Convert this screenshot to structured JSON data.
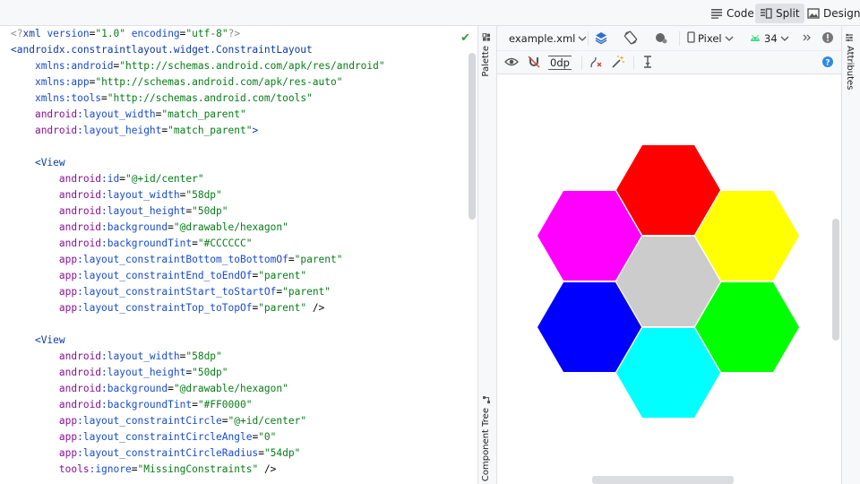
{
  "view_modes": {
    "code": "Code",
    "split": "Split",
    "design": "Design",
    "active": "split"
  },
  "editor": {
    "lines": [
      [
        {
          "t": "<?",
          "c": "dim"
        },
        {
          "t": "xml ",
          "c": "tag"
        },
        {
          "t": "version",
          "c": "an"
        },
        {
          "t": "=",
          "c": "plain"
        },
        {
          "t": "\"1.0\"",
          "c": "str"
        },
        {
          "t": " ",
          "c": "plain"
        },
        {
          "t": "encoding",
          "c": "an"
        },
        {
          "t": "=",
          "c": "plain"
        },
        {
          "t": "\"utf-8\"",
          "c": "str"
        },
        {
          "t": "?>",
          "c": "dim"
        }
      ],
      [
        {
          "t": "<androidx.constraintlayout.widget.ConstraintLayout",
          "c": "tag"
        }
      ],
      [
        {
          "t": "    ",
          "c": "plain"
        },
        {
          "t": "xmlns:android",
          "c": "an"
        },
        {
          "t": "=",
          "c": "plain"
        },
        {
          "t": "\"http://schemas.android.com/apk/res/android\"",
          "c": "str"
        }
      ],
      [
        {
          "t": "    ",
          "c": "plain"
        },
        {
          "t": "xmlns:app",
          "c": "an"
        },
        {
          "t": "=",
          "c": "plain"
        },
        {
          "t": "\"http://schemas.android.com/apk/res-auto\"",
          "c": "str"
        }
      ],
      [
        {
          "t": "    ",
          "c": "plain"
        },
        {
          "t": "xmlns:tools",
          "c": "an"
        },
        {
          "t": "=",
          "c": "plain"
        },
        {
          "t": "\"http://schemas.android.com/tools\"",
          "c": "str"
        }
      ],
      [
        {
          "t": "    ",
          "c": "plain"
        },
        {
          "t": "android",
          "c": "pre"
        },
        {
          "t": ":layout_width",
          "c": "an"
        },
        {
          "t": "=",
          "c": "plain"
        },
        {
          "t": "\"match_parent\"",
          "c": "str"
        }
      ],
      [
        {
          "t": "    ",
          "c": "plain"
        },
        {
          "t": "android",
          "c": "pre"
        },
        {
          "t": ":layout_height",
          "c": "an"
        },
        {
          "t": "=",
          "c": "plain"
        },
        {
          "t": "\"match_parent\"",
          "c": "str"
        },
        {
          "t": ">",
          "c": "tag"
        }
      ],
      [],
      [
        {
          "t": "    ",
          "c": "plain"
        },
        {
          "t": "<View",
          "c": "tag"
        }
      ],
      [
        {
          "t": "        ",
          "c": "plain"
        },
        {
          "t": "android",
          "c": "pre"
        },
        {
          "t": ":id",
          "c": "an"
        },
        {
          "t": "=",
          "c": "plain"
        },
        {
          "t": "\"@+id/center\"",
          "c": "str"
        }
      ],
      [
        {
          "t": "        ",
          "c": "plain"
        },
        {
          "t": "android",
          "c": "pre"
        },
        {
          "t": ":layout_width",
          "c": "an"
        },
        {
          "t": "=",
          "c": "plain"
        },
        {
          "t": "\"58dp\"",
          "c": "str"
        }
      ],
      [
        {
          "t": "        ",
          "c": "plain"
        },
        {
          "t": "android",
          "c": "pre"
        },
        {
          "t": ":layout_height",
          "c": "an"
        },
        {
          "t": "=",
          "c": "plain"
        },
        {
          "t": "\"50dp\"",
          "c": "str"
        }
      ],
      [
        {
          "t": "        ",
          "c": "plain"
        },
        {
          "t": "android",
          "c": "pre"
        },
        {
          "t": ":background",
          "c": "an"
        },
        {
          "t": "=",
          "c": "plain"
        },
        {
          "t": "\"@drawable/hexagon\"",
          "c": "str"
        }
      ],
      [
        {
          "t": "        ",
          "c": "plain"
        },
        {
          "t": "android",
          "c": "pre"
        },
        {
          "t": ":backgroundTint",
          "c": "an"
        },
        {
          "t": "=",
          "c": "plain"
        },
        {
          "t": "\"#CCCCCC\"",
          "c": "str"
        }
      ],
      [
        {
          "t": "        ",
          "c": "plain"
        },
        {
          "t": "app",
          "c": "pre"
        },
        {
          "t": ":layout_constraintBottom_toBottomOf",
          "c": "an"
        },
        {
          "t": "=",
          "c": "plain"
        },
        {
          "t": "\"parent\"",
          "c": "str"
        }
      ],
      [
        {
          "t": "        ",
          "c": "plain"
        },
        {
          "t": "app",
          "c": "pre"
        },
        {
          "t": ":layout_constraintEnd_toEndOf",
          "c": "an"
        },
        {
          "t": "=",
          "c": "plain"
        },
        {
          "t": "\"parent\"",
          "c": "str"
        }
      ],
      [
        {
          "t": "        ",
          "c": "plain"
        },
        {
          "t": "app",
          "c": "pre"
        },
        {
          "t": ":layout_constraintStart_toStartOf",
          "c": "an"
        },
        {
          "t": "=",
          "c": "plain"
        },
        {
          "t": "\"parent\"",
          "c": "str"
        }
      ],
      [
        {
          "t": "        ",
          "c": "plain"
        },
        {
          "t": "app",
          "c": "pre"
        },
        {
          "t": ":layout_constraintTop_toTopOf",
          "c": "an"
        },
        {
          "t": "=",
          "c": "plain"
        },
        {
          "t": "\"parent\"",
          "c": "str"
        },
        {
          "t": " />",
          "c": "plain"
        }
      ],
      [],
      [
        {
          "t": "    ",
          "c": "plain"
        },
        {
          "t": "<View",
          "c": "tag"
        }
      ],
      [
        {
          "t": "        ",
          "c": "plain"
        },
        {
          "t": "android",
          "c": "pre"
        },
        {
          "t": ":layout_width",
          "c": "an"
        },
        {
          "t": "=",
          "c": "plain"
        },
        {
          "t": "\"58dp\"",
          "c": "str"
        }
      ],
      [
        {
          "t": "        ",
          "c": "plain"
        },
        {
          "t": "android",
          "c": "pre"
        },
        {
          "t": ":layout_height",
          "c": "an"
        },
        {
          "t": "=",
          "c": "plain"
        },
        {
          "t": "\"50dp\"",
          "c": "str"
        }
      ],
      [
        {
          "t": "        ",
          "c": "plain"
        },
        {
          "t": "android",
          "c": "pre"
        },
        {
          "t": ":background",
          "c": "an"
        },
        {
          "t": "=",
          "c": "plain"
        },
        {
          "t": "\"@drawable/hexagon\"",
          "c": "str"
        }
      ],
      [
        {
          "t": "        ",
          "c": "plain"
        },
        {
          "t": "android",
          "c": "pre"
        },
        {
          "t": ":backgroundTint",
          "c": "an"
        },
        {
          "t": "=",
          "c": "plain"
        },
        {
          "t": "\"#FF0000\"",
          "c": "str"
        }
      ],
      [
        {
          "t": "        ",
          "c": "plain"
        },
        {
          "t": "app",
          "c": "pre"
        },
        {
          "t": ":layout_constraintCircle",
          "c": "an"
        },
        {
          "t": "=",
          "c": "plain"
        },
        {
          "t": "\"@+id/center\"",
          "c": "str"
        }
      ],
      [
        {
          "t": "        ",
          "c": "plain"
        },
        {
          "t": "app",
          "c": "pre"
        },
        {
          "t": ":layout_constraintCircleAngle",
          "c": "an"
        },
        {
          "t": "=",
          "c": "plain"
        },
        {
          "t": "\"0\"",
          "c": "str"
        }
      ],
      [
        {
          "t": "        ",
          "c": "plain"
        },
        {
          "t": "app",
          "c": "pre"
        },
        {
          "t": ":layout_constraintCircleRadius",
          "c": "an"
        },
        {
          "t": "=",
          "c": "plain"
        },
        {
          "t": "\"54dp\"",
          "c": "str"
        }
      ],
      [
        {
          "t": "        ",
          "c": "plain"
        },
        {
          "t": "tools",
          "c": "pre"
        },
        {
          "t": ":ignore",
          "c": "an"
        },
        {
          "t": "=",
          "c": "plain"
        },
        {
          "t": "\"MissingConstraints\"",
          "c": "str"
        },
        {
          "t": " />",
          "c": "plain"
        }
      ]
    ]
  },
  "side_panels": {
    "palette": "Palette",
    "component_tree": "Component Tree",
    "attributes": "Attributes"
  },
  "design_toolbar": {
    "file": "example.xml",
    "device": "Pixel",
    "api_level": "34",
    "margin": "0dp"
  },
  "hexagons": [
    {
      "name": "center",
      "color": "#CCCCCC",
      "angle": null
    },
    {
      "name": "red",
      "color": "#FF0000",
      "angle": 0
    },
    {
      "name": "yellow",
      "color": "#FFFF00",
      "angle": 60
    },
    {
      "name": "green",
      "color": "#00FF00",
      "angle": 120
    },
    {
      "name": "cyan",
      "color": "#00FFFF",
      "angle": 180
    },
    {
      "name": "blue",
      "color": "#0000FF",
      "angle": 240
    },
    {
      "name": "magenta",
      "color": "#FF00FF",
      "angle": 300
    }
  ]
}
